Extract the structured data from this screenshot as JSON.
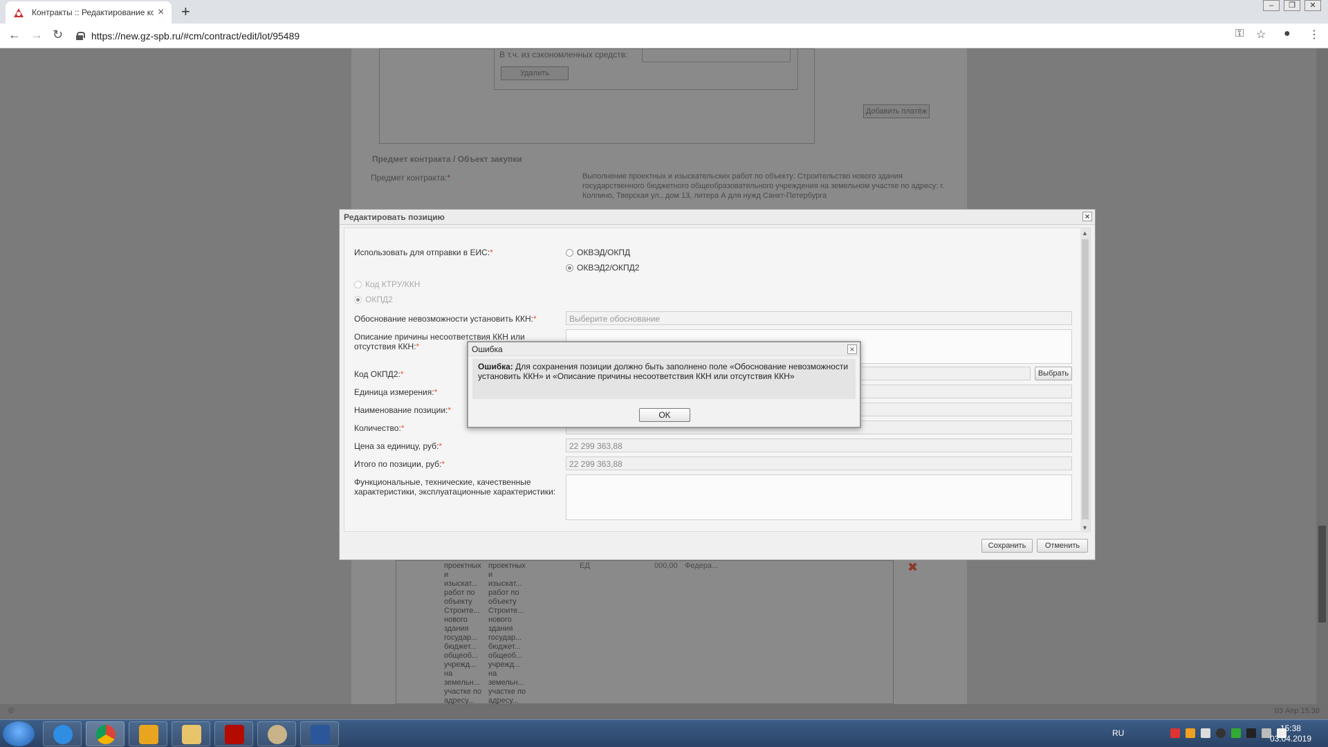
{
  "browser": {
    "tab_title": "Контракты :: Редактирование ко",
    "url": "https://new.gz-spb.ru/#cm/contract/edit/lot/95489"
  },
  "background": {
    "econ_label": "В т.ч. из сэкономленных средств:",
    "delete_btn": "Удалить",
    "add_payment_btn": "Добавить платёж",
    "section_legend": "Предмет контракта / Объект закупки",
    "subject_label": "Предмет контракта:",
    "subject_text": "Выполнение проектных и изыскательских работ по объекту: Строительство нового здания государственного бюджетного общеобразовательного учреждения на земельном участке по адресу: г. Колпино, Тверская ул., дом 13, литера А для нужд Санкт-Петербурга",
    "table_col1": "проектных и изыскат... работ по объекту Строите... нового здания государ... бюджет... общеоб... учрежд... на земельн... участке по адресу...",
    "table_col2": "проектных и изыскат... работ по объекту Строите... нового здания государ... бюджет... общеоб... учрежд... на земельн... участке по адресу...",
    "table_unit": "ЕД",
    "table_qty": "000,00",
    "table_src": "Федера...",
    "copyright": "©",
    "status_date": "03 Апр 15:38"
  },
  "dialog": {
    "title": "Редактировать позицию",
    "eis_label": "Использовать для отправки в ЕИС:",
    "opt_okved": "ОКВЭД/ОКПД",
    "opt_okved2": "ОКВЭД2/ОКПД2",
    "opt_ktru": "Код КТРУ/ККН",
    "opt_okpd2": "ОКПД2",
    "reason_label": "Обоснование невозможности установить ККН:",
    "reason_placeholder": "Выберите обоснование",
    "desc_label": "Описание причины несоответствия ККН или отсутствия ККН:",
    "okpd2_label": "Код ОКПД2:",
    "choose_btn": "Выбрать",
    "unit_label": "Единица измерения:",
    "name_label": "Наименование позиции:",
    "qty_label": "Количество:",
    "price_label": "Цена за единицу, руб:",
    "price_value": "22 299 363,88",
    "total_label": "Итого по позиции, руб:",
    "total_value": "22 299 363,88",
    "chars_label": "Функциональные, технические, качественные характеристики, эксплуатационные характеристики:",
    "save_btn": "Сохранить",
    "cancel_btn": "Отменить",
    "req_mark": "*"
  },
  "error": {
    "title": "Ошибка",
    "msg_bold": "Ошибка:",
    "msg_text": "Для сохранения позиции должно быть заполнено поле «Обоснование невозможности установить ККН» и «Описание причины несоответствия ККН или отсутствия ККН»",
    "ok_btn": "OK"
  },
  "taskbar": {
    "lang": "RU",
    "time": "15:38",
    "date": "03.04.2019"
  }
}
